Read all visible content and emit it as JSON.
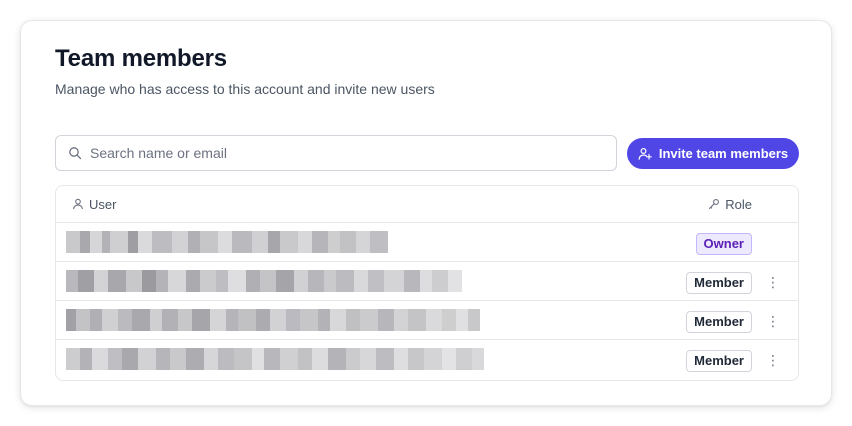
{
  "header": {
    "title": "Team members",
    "subtitle": "Manage who has access to this account and invite new users"
  },
  "search": {
    "placeholder": "Search name or email",
    "value": ""
  },
  "invite_button": {
    "label": "Invite team members"
  },
  "table": {
    "columns": {
      "user": "User",
      "role": "Role"
    },
    "rows": [
      {
        "role": "Owner",
        "has_menu": false
      },
      {
        "role": "Member",
        "has_menu": true
      },
      {
        "role": "Member",
        "has_menu": true
      },
      {
        "role": "Member",
        "has_menu": true
      }
    ]
  },
  "colors": {
    "accent": "#4f46e5",
    "owner_badge_bg": "#ede9fe",
    "owner_badge_text": "#5b21b6"
  },
  "icons": {
    "search": "search-icon",
    "invite": "user-plus-icon",
    "user_column": "user-icon",
    "role_column": "key-icon",
    "row_menu": "more-vertical-icon"
  }
}
